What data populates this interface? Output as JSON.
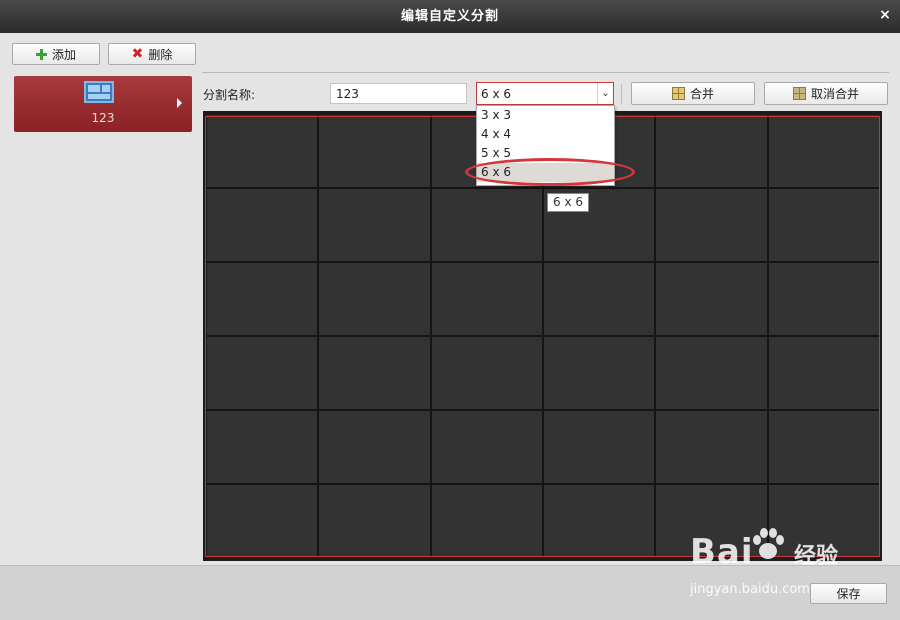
{
  "window": {
    "title": "编辑自定义分割",
    "close_label": "×"
  },
  "toolbar": {
    "add_label": "添加",
    "delete_label": "删除"
  },
  "sidebar": {
    "items": [
      {
        "label": "123",
        "icon": "layout-icon",
        "selected": true
      }
    ]
  },
  "form": {
    "name_label": "分割名称:",
    "name_value": "123",
    "grid_select": {
      "selected": "6 x 6",
      "options": [
        "3 x 3",
        "4 x 4",
        "5 x 5",
        "6 x 6"
      ],
      "highlighted_index": 3
    },
    "merge_label": "合并",
    "unmerge_label": "取消合并"
  },
  "tooltip": {
    "text": "6 x 6"
  },
  "grid": {
    "rows": 6,
    "cols": 6
  },
  "footer": {
    "save_label": "保存"
  },
  "watermark": {
    "main": "Bai",
    "main_suffix": "经验",
    "sub": "jingyan.baidu.com"
  },
  "colors": {
    "accent_red": "#c8383b",
    "sidebar_item": "#a63a3e",
    "canvas_cell": "#333333",
    "add_green": "#3aa23a"
  }
}
